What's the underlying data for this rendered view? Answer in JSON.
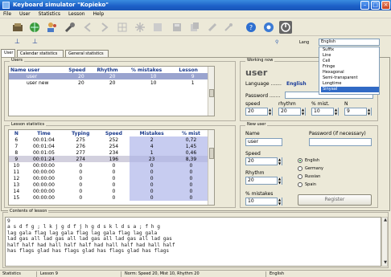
{
  "window": {
    "title": "Keyboard simulator \"Kopieko\""
  },
  "menu": [
    "File",
    "User",
    "Statistics",
    "Lesson",
    "Help"
  ],
  "toolbar": {
    "icons": [
      "open-icon",
      "globe-icon",
      "users-icon",
      "wrench-icon",
      "back-icon",
      "forward-icon",
      "grid-icon",
      "grid-icon",
      "save-icon",
      "copy-icon",
      "paint-icon",
      "paint-icon",
      "help-icon",
      "settings-icon",
      "stop-icon"
    ],
    "lang_label": "Lang",
    "lang_value": "English"
  },
  "lang_options": [
    "Suffix",
    "Line",
    "Cell",
    "Fringe",
    "Hexagonal",
    "Semi-transparent",
    "Longtime",
    "Sinyaal"
  ],
  "lang_selected_index": 7,
  "tabs": [
    "User",
    "Calendar statistics",
    "General statistics"
  ],
  "users": {
    "title": "Users",
    "columns": [
      "Name user",
      "Speed",
      "Rhythm",
      "% mistakes",
      "Lesson"
    ],
    "rows": [
      [
        "user",
        "20",
        "20",
        "10",
        "9"
      ],
      [
        "user new",
        "20",
        "20",
        "10",
        "1"
      ]
    ],
    "selected_row": 0
  },
  "working": {
    "title": "Working now",
    "user_name": "user",
    "language_label": "Language .......",
    "language_value": "English",
    "password_label": "Password .......",
    "speed_label": "speed",
    "rhythm_label": "rhythm",
    "mist_label": "% mist.",
    "n_label": "N",
    "speed": "20",
    "rhythm": "20",
    "mist": "10",
    "n": "9"
  },
  "lesson_stats": {
    "title": "Lesson statistics",
    "columns": [
      "N",
      "Time",
      "Typing",
      "Speed",
      "Mistakes",
      "% mist"
    ],
    "rows": [
      [
        "6",
        "00:01:04",
        "275",
        "252",
        "2",
        "0,72"
      ],
      [
        "7",
        "00:01:04",
        "276",
        "254",
        "4",
        "1,45"
      ],
      [
        "8",
        "00:01:05",
        "277",
        "234",
        "1",
        "0,46"
      ],
      [
        "9",
        "00:01:24",
        "274",
        "196",
        "23",
        "8,39"
      ],
      [
        "10",
        "00:00:00",
        "0",
        "0",
        "0",
        "0"
      ],
      [
        "11",
        "00:00:00",
        "0",
        "0",
        "0",
        "0"
      ],
      [
        "12",
        "00:00:00",
        "0",
        "0",
        "0",
        "0"
      ],
      [
        "13",
        "00:00:00",
        "0",
        "0",
        "0",
        "0"
      ],
      [
        "14",
        "00:00:00",
        "0",
        "0",
        "0",
        "0"
      ],
      [
        "15",
        "00:00:00",
        "0",
        "0",
        "0",
        "0"
      ]
    ],
    "highlight_row": 3
  },
  "new_user": {
    "title": "New user",
    "name_label": "Name",
    "name_value": "user",
    "password_label": "Password (if necessary)",
    "speed_label": "Speed",
    "speed_value": "20",
    "rhythm_label": "Rhythm",
    "rhythm_value": "20",
    "mist_label": "% mistakes",
    "mist_value": "10",
    "languages": [
      "English",
      "Germany",
      "Russian",
      "Spain"
    ],
    "selected_language": 0,
    "register_label": "Register"
  },
  "lesson": {
    "title": "Contents of lesson",
    "lines": [
      "9",
      "a s d f g ; l k j g d f j h g d s k l d s a ; f h g",
      "lag gala flag lag gala flag lag gala flag lag gala",
      "lad gas all lad gas all lad gas all lad gas all lad gas",
      "half half had hall half half had hall half had hall half",
      "has flags glad has flags glad has flags glad has flags"
    ]
  },
  "status": {
    "left": "Statistics",
    "lesson": "Lesson 9",
    "norm": "Norm: Speed 20, Mist 10, Rhythm 20",
    "lang": "English"
  }
}
